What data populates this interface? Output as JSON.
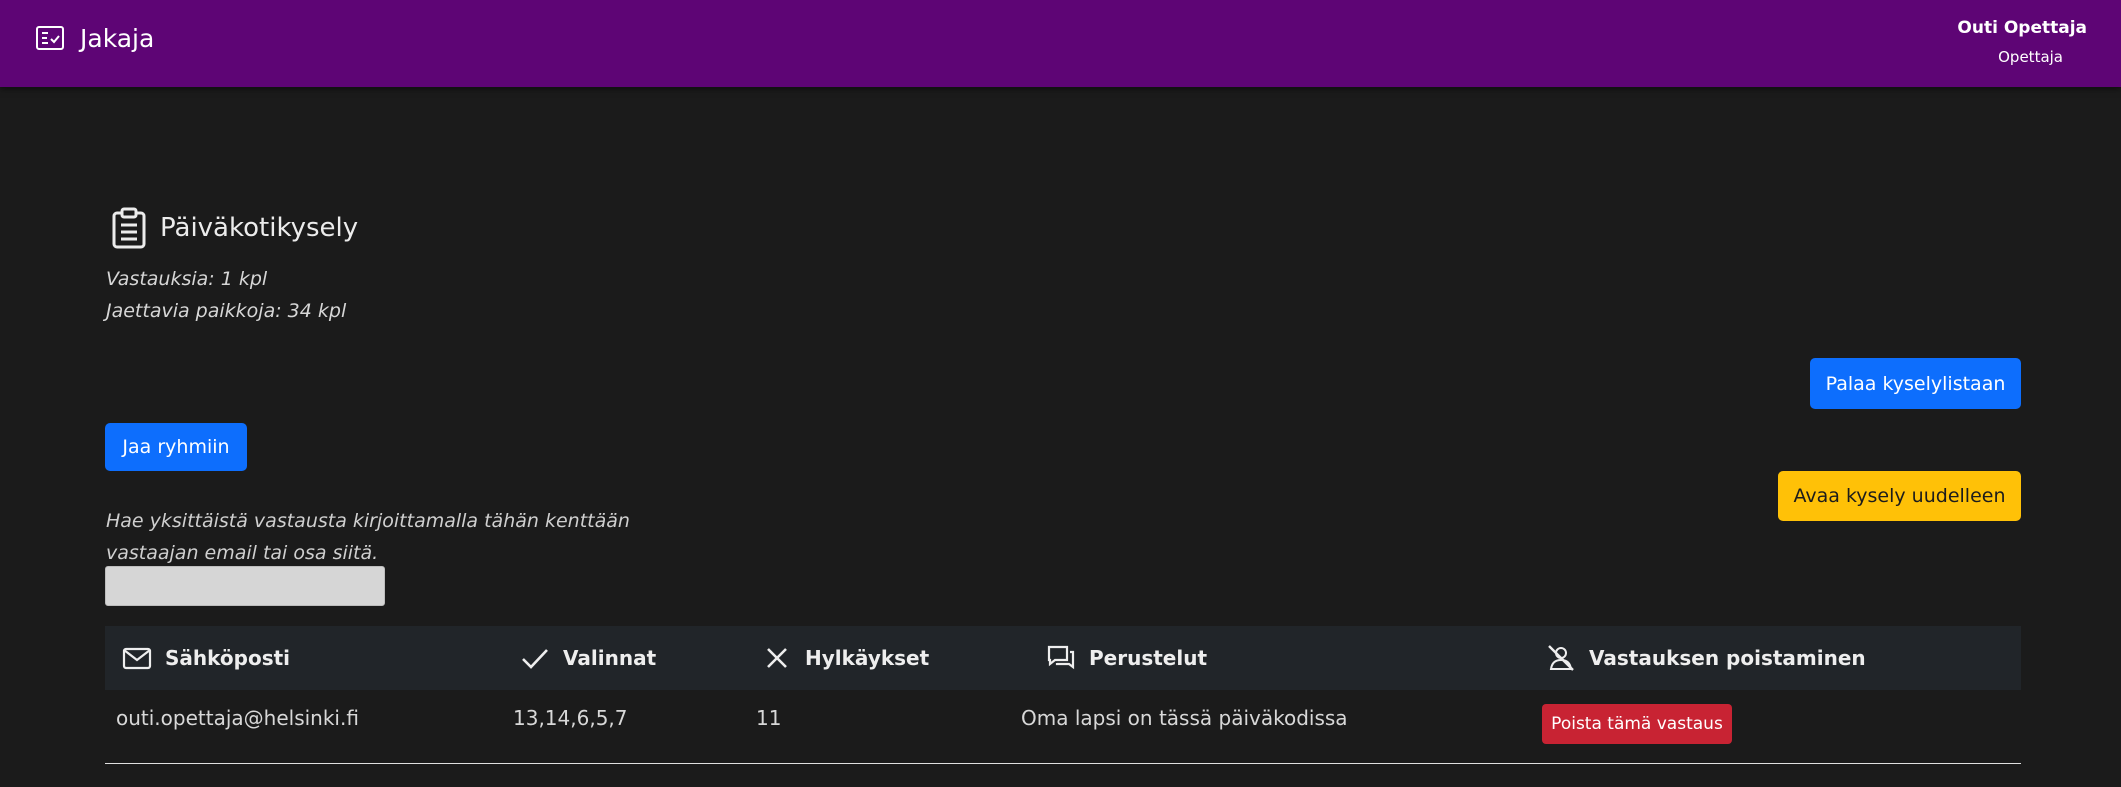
{
  "header": {
    "app_name": "Jakaja",
    "user_name": "Outi Opettaja",
    "user_role": "Opettaja"
  },
  "survey": {
    "title": "Päiväkotikysely",
    "responses": "Vastauksia: 1 kpl",
    "places": "Jaettavia paikkoja: 34 kpl"
  },
  "actions": {
    "back_label": "Palaa kyselylistaan",
    "share_label": "Jaa ryhmiin",
    "reopen_label": "Avaa kysely uudelleen"
  },
  "search": {
    "help_text": "Hae yksittäistä vastausta kirjoittamalla tähän kenttään vastaajan email tai osa siitä.",
    "value": "",
    "placeholder": ""
  },
  "table": {
    "columns": [
      {
        "label": "Sähköposti",
        "icon": "envelope-icon"
      },
      {
        "label": "Valinnat",
        "icon": "check-icon"
      },
      {
        "label": "Hylkäykset",
        "icon": "x-icon"
      },
      {
        "label": "Perustelut",
        "icon": "chat-icon"
      },
      {
        "label": "Vastauksen poistaminen",
        "icon": "person-slash-icon"
      }
    ],
    "rows": [
      {
        "email": "outi.opettaja@helsinki.fi",
        "choices": "13,14,6,5,7",
        "rejections": "11",
        "reasons": "Oma lapsi on tässä päiväkodissa",
        "delete_label": "Poista tämä vastaus"
      }
    ]
  },
  "colors": {
    "topbar": "#5e0575",
    "background": "#1b1b1b",
    "primary": "#0d6efd",
    "warning": "#ffc107",
    "danger": "#c82333",
    "table_header": "#212529"
  }
}
